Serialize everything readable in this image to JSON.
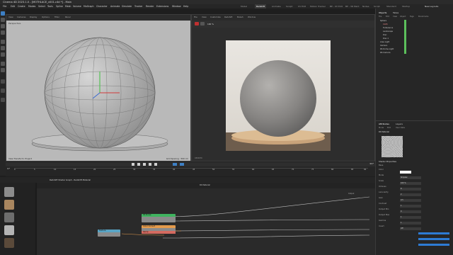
{
  "window": {
    "title": "Cinema 4D 2023.1.0 - [MOTHLACE_v001.c4d *] - Main"
  },
  "menu": {
    "items": [
      "File",
      "Edit",
      "Create",
      "Modes",
      "Select",
      "Tools",
      "Spline",
      "Mesh",
      "Volume",
      "MoGraph",
      "Character",
      "Animate",
      "Simulate",
      "Tracker",
      "Render",
      "Extensions",
      "Window",
      "Help"
    ],
    "layouts": [
      "Model",
      "Redshift",
      "Animate",
      "Sculpt",
      "UV Edit",
      "Motion Tracker",
      "BP - UV Edit",
      "BP - 3D Paint",
      "Nodes",
      "Script",
      "Standard",
      "Startup"
    ],
    "active_layout": "Redshift",
    "new_layouts_label": "New Layouts"
  },
  "viewport_left": {
    "menu": [
      "View",
      "Cameras",
      "Display",
      "Options",
      "Filter",
      "Panel"
    ],
    "label": "Perspective",
    "footer_left": "View Transform: Project",
    "footer_right": "Grid Spacing : 500 cm"
  },
  "viewport_right": {
    "menu": [
      "File",
      "View",
      "Customize",
      "Redshift",
      "Bokeh",
      "Window"
    ],
    "zoom": "100 %",
    "footer": "RENDER"
  },
  "timeline": {
    "frames": [
      "0",
      "5",
      "10",
      "15",
      "20",
      "25",
      "30",
      "35",
      "40",
      "45",
      "50",
      "55",
      "60",
      "65",
      "70",
      "75",
      "80",
      "85",
      "90"
    ],
    "current": "0 F",
    "end": "90 F"
  },
  "node_editor": {
    "title": "Redshift Shader Graph - Redshift Material",
    "header": "RS Material",
    "nodes": [
      {
        "name": "Texture",
        "color": "#59a4c4"
      },
      {
        "name": "RS Noise",
        "color": "#3fb35f"
      },
      {
        "name": "Color Correct",
        "color": "#e39a4c"
      },
      {
        "name": "Ramp",
        "color": "#d46a5f"
      },
      {
        "name": "Output",
        "color": "#c44a4a"
      }
    ]
  },
  "objects": {
    "tabs": [
      "Objects",
      "Takes"
    ],
    "menu": [
      "File",
      "Edit",
      "View",
      "Object",
      "Tags",
      "Bookmarks"
    ],
    "items": [
      "Sphere",
      "Cloth",
      "Turbulence",
      "Landscape",
      "Disc",
      "Disc.1",
      "Area Light",
      "Camera",
      "RS Dome Light",
      "RS Camera"
    ]
  },
  "attributes": {
    "tabs": [
      "Attributes",
      "Layers"
    ],
    "menu": [
      "Mode",
      "Edit",
      "User Data"
    ],
    "selection": "RS Material",
    "section": "Shader Properties",
    "rows": [
      {
        "label": "Base",
        "value": ""
      },
      {
        "label": "Color",
        "value": ""
      },
      {
        "label": "Mode",
        "value": "Simplex"
      },
      {
        "label": "Scale",
        "value": "100 %"
      },
      {
        "label": "Octaves",
        "value": "8"
      },
      {
        "label": "Lacunarity",
        "value": "2"
      },
      {
        "label": "Gain",
        "value": "0.5"
      },
      {
        "label": "Contrast",
        "value": "1"
      },
      {
        "label": "Output Min",
        "value": "0"
      },
      {
        "label": "Output Max",
        "value": "1"
      },
      {
        "label": "Gamma",
        "value": "1"
      },
      {
        "label": "Invert",
        "value": "Off"
      }
    ]
  },
  "colors": {
    "accent": "#2d7bd4",
    "node_texture": "#59a4c4",
    "node_noise": "#3fb35f",
    "node_color": "#e39a4c"
  }
}
